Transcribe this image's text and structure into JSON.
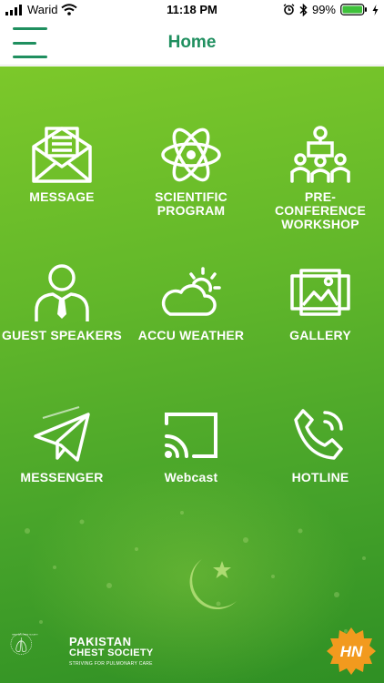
{
  "status_bar": {
    "carrier": "Warid",
    "time": "11:18 PM",
    "battery": "99%"
  },
  "header": {
    "title": "Home"
  },
  "tiles": [
    {
      "label": "MESSAGE",
      "icon": "envelope-icon"
    },
    {
      "label": "SCIENTIFIC PROGRAM",
      "icon": "atom-icon"
    },
    {
      "label": "PRE-CONFERENCE WORKSHOP",
      "icon": "presentation-icon"
    },
    {
      "label": "GUEST SPEAKERS",
      "icon": "person-tie-icon"
    },
    {
      "label": "ACCU WEATHER",
      "icon": "weather-cloud-sun-icon"
    },
    {
      "label": "GALLERY",
      "icon": "gallery-image-icon"
    },
    {
      "label": "MESSENGER",
      "icon": "paper-plane-icon"
    },
    {
      "label": "Webcast",
      "icon": "cast-icon"
    },
    {
      "label": "HOTLINE",
      "icon": "phone-icon"
    }
  ],
  "footer": {
    "org_name_line1": "PAKISTAN",
    "org_name_line2": "CHEST SOCIETY",
    "org_tagline": "STRIVING FOR PULMONARY CARE",
    "seal_text": "PAKISTAN CHEST SOCIETY",
    "badge_text": "HN"
  },
  "colors": {
    "accent": "#1f8f5f",
    "background_top": "#7cc82a",
    "background_bottom": "#2f8f24"
  }
}
